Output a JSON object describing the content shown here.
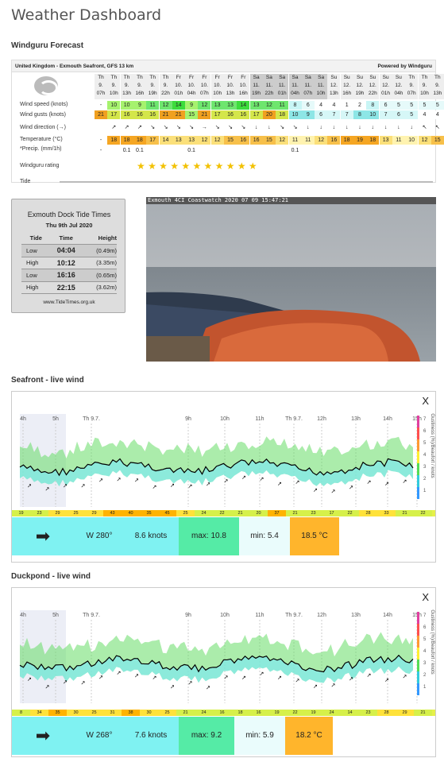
{
  "page_title": "Weather Dashboard",
  "windguru": {
    "section_title": "Windguru Forecast",
    "location": "United Kingdom - Exmouth Seafront, GFS 13 km",
    "powered_by": "Powered by Windguru",
    "row_labels": [
      "Wind speed (knots)",
      "Wind gusts (knots)",
      "Wind direction (→)",
      "Temperature (°C)",
      "*Precip. (mm/1h)",
      "Windguru rating",
      "Tide"
    ],
    "days": [
      "Th",
      "Th",
      "Th",
      "Th",
      "Th",
      "Th",
      "Fr",
      "Fr",
      "Fr",
      "Fr",
      "Fr",
      "Fr",
      "Sa",
      "Sa",
      "Sa",
      "Sa",
      "Sa",
      "Sa",
      "Su",
      "Su",
      "Su",
      "Su",
      "Su",
      "Su"
    ],
    "dates": [
      "9.",
      "9.",
      "9.",
      "9.",
      "9.",
      "9.",
      "10.",
      "10.",
      "10.",
      "10.",
      "10.",
      "10.",
      "11.",
      "11.",
      "11.",
      "11.",
      "11.",
      "11.",
      "12.",
      "12.",
      "12.",
      "12.",
      "12.",
      "12."
    ],
    "hours": [
      "07h",
      "10h",
      "13h",
      "16h",
      "19h",
      "22h",
      "01h",
      "04h",
      "07h",
      "10h",
      "13h",
      "16h",
      "19h",
      "22h",
      "01h",
      "04h",
      "07h",
      "10h",
      "13h",
      "16h",
      "19h",
      "22h",
      "01h",
      "04h",
      "07h",
      "10h",
      "13h",
      "16h"
    ],
    "speed": [
      "-",
      "10",
      "10",
      "9",
      "11",
      "12",
      "14",
      "9",
      "12",
      "13",
      "13",
      "14",
      "13",
      "12",
      "11",
      "8",
      "6",
      "4",
      "4",
      "1",
      "2",
      "8",
      "6",
      "5",
      "5",
      "5",
      "5",
      "5"
    ],
    "gusts": [
      "21",
      "17",
      "16",
      "16",
      "16",
      "21",
      "21",
      "15",
      "21",
      "17",
      "16",
      "16",
      "17",
      "20",
      "18",
      "10",
      "9",
      "6",
      "7",
      "7",
      "8",
      "10",
      "7",
      "6",
      "5",
      "4",
      "4",
      "3"
    ],
    "directions": [
      "",
      "↗",
      "↗",
      "↗",
      "↘",
      "↘",
      "↘",
      "↘",
      "→",
      "↘",
      "↘",
      "↘",
      "↓",
      "↓",
      "↘",
      "↘",
      "↓",
      "↓",
      "↓",
      "↓",
      "↓",
      "↓",
      "↓",
      "↓",
      "↓",
      "↖",
      "↖",
      "↑"
    ],
    "temperature": [
      "-",
      "18",
      "18",
      "18",
      "17",
      "14",
      "13",
      "13",
      "12",
      "12",
      "15",
      "16",
      "16",
      "15",
      "12",
      "11",
      "11",
      "12",
      "16",
      "18",
      "19",
      "18",
      "13",
      "11",
      "10",
      "12",
      "15",
      "16"
    ],
    "temperature_tail": "17",
    "precip": [
      "-",
      "",
      "0.1",
      "0.1",
      "",
      "",
      "",
      "0.1",
      "",
      "",
      "",
      "",
      "",
      "",
      "",
      "0.1",
      "",
      "",
      "",
      "",
      "",
      "",
      "",
      "",
      "",
      "",
      "",
      ""
    ],
    "rating_stars": "★ ★ ★        ★ ★ ★ ★ ★ ★ ★ ★"
  },
  "tide": {
    "title": "Exmouth Dock Tide Times",
    "date": "Thu 9th Jul 2020",
    "headers": [
      "Tide",
      "Time",
      "Height"
    ],
    "rows": [
      {
        "tide": "Low",
        "time": "04:04",
        "height": "(0.49m)"
      },
      {
        "tide": "High",
        "time": "10:12",
        "height": "(3.35m)"
      },
      {
        "tide": "Low",
        "time": "16:16",
        "height": "(0.65m)"
      },
      {
        "tide": "High",
        "time": "22:15",
        "height": "(3.62m)"
      }
    ],
    "source": "www.TideTimes.org.uk"
  },
  "webcam": {
    "overlay": "Exmouth 4CI  Coastwatch 2020 07 09 15:47:21"
  },
  "seafront": {
    "section_title": "Seafront - live wind",
    "close": "X",
    "top_labels": [
      "4h",
      "5h",
      "Th 9.7.",
      "9h",
      "10h",
      "11h",
      "Th 9.7.",
      "12h",
      "13h",
      "14h",
      "15h"
    ],
    "axis_title": "Gustiness (%)/Beaufort / knots",
    "y_ticks": [
      "7",
      "6",
      "5",
      "4",
      "3",
      "2",
      "1"
    ],
    "beaufort": [
      "19",
      "23",
      "29",
      "25",
      "29",
      "43",
      "40",
      "35",
      "45",
      "25",
      "24",
      "22",
      "21",
      "20",
      "37",
      "21",
      "23",
      "17",
      "22",
      "28",
      "33",
      "21",
      "22"
    ],
    "direction": "W 280°",
    "speed": "8.6 knots",
    "max": "max: 10.8",
    "min": "min: 5.4",
    "temp": "18.5 °C"
  },
  "duckpond": {
    "section_title": "Duckpond - live wind",
    "close": "X",
    "top_labels": [
      "4h",
      "5h",
      "Th 9.7.",
      "9h",
      "10h",
      "11h",
      "Th 9.7.",
      "12h",
      "13h",
      "14h",
      "15h"
    ],
    "axis_title": "Gustiness (%)/Beaufort / knots",
    "y_ticks": [
      "7",
      "6",
      "5",
      "4",
      "3",
      "2",
      "1"
    ],
    "beaufort": [
      "8",
      "34",
      "35",
      "30",
      "25",
      "31",
      "38",
      "30",
      "25",
      "21",
      "24",
      "16",
      "18",
      "16",
      "19",
      "22",
      "19",
      "24",
      "14",
      "23",
      "28",
      "29",
      "21"
    ],
    "direction": "W 268°",
    "speed": "7.6 knots",
    "max": "max: 9.2",
    "min": "min: 5.9",
    "temp": "18.2 °C"
  },
  "colors": {
    "info_cyan": "#7ff2f2",
    "info_green": "#55eba6",
    "temp_orange": "#ffb52c",
    "bar_yellow": "#e6f04a"
  }
}
